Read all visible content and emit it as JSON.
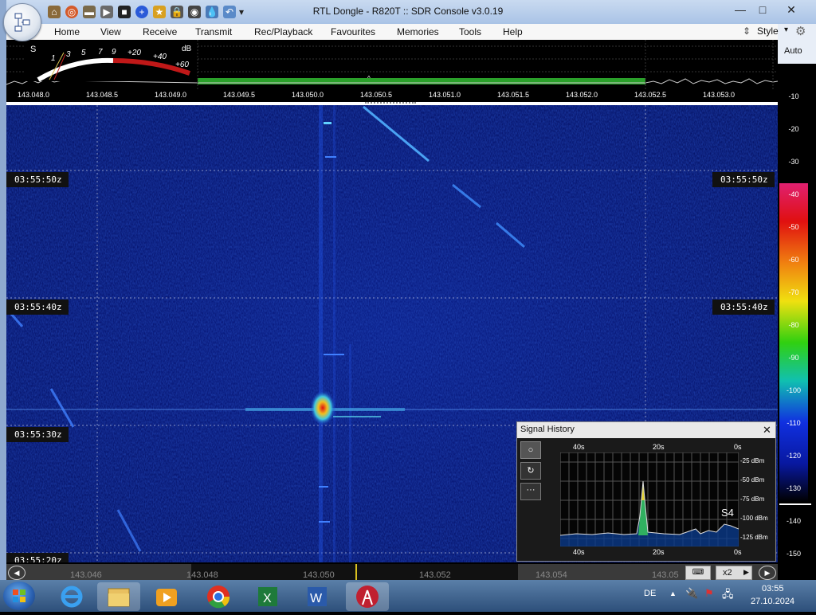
{
  "window": {
    "title": "RTL Dongle - R820T :: SDR Console v3.0.19"
  },
  "menu": [
    "Home",
    "View",
    "Receive",
    "Transmit",
    "Rec/Playback",
    "Favourites",
    "Memories",
    "Tools",
    "Help"
  ],
  "style_label": "Style",
  "auto_label": "Auto",
  "smeter": {
    "s_label": "S",
    "db_label": "dB",
    "scale": [
      "1",
      "3",
      "5",
      "7",
      "9",
      "+20",
      "+40",
      "+60"
    ]
  },
  "freq_scale": [
    "143.048.0",
    "143.048.5",
    "143.049.0",
    "143.049.5",
    "143.050.0",
    "143.050.5",
    "143.051.0",
    "143.051.5",
    "143.052.0",
    "143.052.5",
    "143.053.0"
  ],
  "time_labels": [
    "03:55:50z",
    "03:55:40z",
    "03:55:30z",
    "03:55:20z"
  ],
  "db_scale": [
    "-10",
    "-20",
    "-30",
    "-40",
    "-50",
    "-60",
    "-70",
    "-80",
    "-90",
    "-100",
    "-110",
    "-120",
    "-130",
    "-140",
    "-150"
  ],
  "signal_history": {
    "title": "Signal History",
    "top_x": [
      "40s",
      "20s",
      "0s"
    ],
    "bottom_x": [
      "40s",
      "20s",
      "0s"
    ],
    "y_labels": [
      "-25 dBm",
      "-50 dBm",
      "-75 dBm",
      "-100 dBm",
      "-125 dBm"
    ],
    "s_value": "S4"
  },
  "bottom_freqs": [
    "143.046",
    "143.048",
    "143.050",
    "143.052",
    "143.054",
    "143.05"
  ],
  "bottom_zoom": "x2",
  "taskbar": {
    "lang": "DE",
    "time": "03:55",
    "date": "27.10.2024"
  }
}
